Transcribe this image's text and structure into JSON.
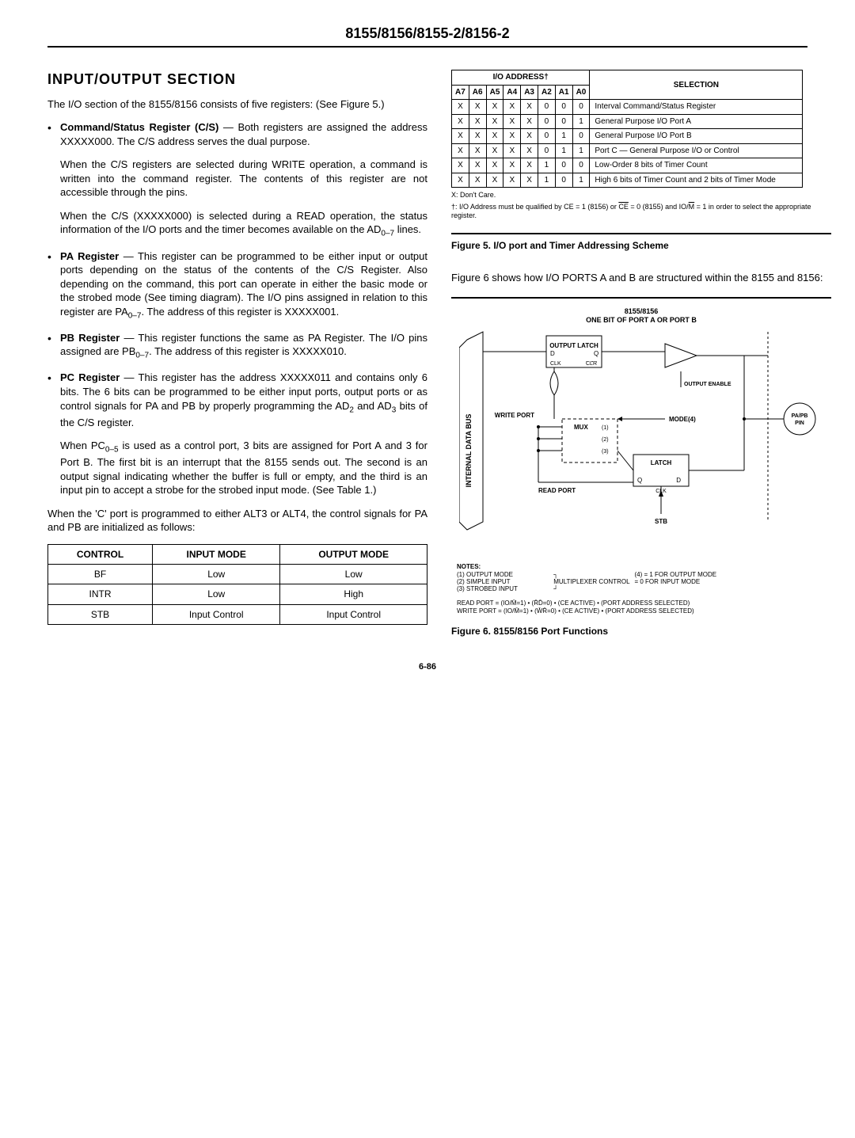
{
  "header": {
    "title": "8155/8156/8155-2/8156-2"
  },
  "left": {
    "section_title": "INPUT/OUTPUT SECTION",
    "intro": "The I/O section of the 8155/8156 consists of five registers: (See Figure 5.)",
    "cs_title": "Command/Status Register (C/S)",
    "cs_p1": " — Both registers are assigned the address XXXXX000. The C/S address serves the dual purpose.",
    "cs_p2": "When the C/S registers are selected during WRITE operation, a command is written into the command register. The contents of this register are not accessible through the pins.",
    "cs_p3_a": "When the C/S (XXXXX000) is selected during a READ operation, the status information of the I/O ports and the timer becomes available on the AD",
    "cs_p3_b": " lines.",
    "pa_title": "PA Register",
    "pa_p1_a": " — This register can be programmed to be either input or output ports depending on the status of the contents of the C/S Register. Also depending on the command, this port can operate in either the basic mode or the strobed mode (See timing diagram). The I/O pins assigned in relation to this register are PA",
    "pa_p1_b": ". The address of this register is XXXXX001.",
    "pb_title": "PB Register",
    "pb_p1_a": " — This register functions the same as PA Register. The I/O pins assigned are PB",
    "pb_p1_b": ". The address of this register is XXXXX010.",
    "pc_title": "PC Register",
    "pc_p1_a": " — This register has the address XXXXX011 and contains only 6 bits. The 6 bits can be programmed to be either input ports, output ports or as control signals for PA and PB by properly programming the AD",
    "pc_p1_b": " and AD",
    "pc_p1_c": " bits of the C/S register.",
    "pc_p2_a": "When PC",
    "pc_p2_b": " is used as a control port, 3 bits are assigned for Port A and 3 for Port B. The first bit is an interrupt that the 8155 sends out. The second is an output signal indicating whether the buffer is full or empty, and the third is an input pin to accept a strobe for the strobed input mode. (See Table 1.)",
    "alt_para": "When the 'C' port is programmed to either ALT3 or ALT4, the control signals for PA and PB are initialized as follows:",
    "ctrl_table": {
      "headers": [
        "CONTROL",
        "INPUT MODE",
        "OUTPUT MODE"
      ],
      "rows": [
        [
          "BF",
          "Low",
          "Low"
        ],
        [
          "INTR",
          "Low",
          "High"
        ],
        [
          "STB",
          "Input Control",
          "Input Control"
        ]
      ]
    }
  },
  "right": {
    "addr_header_group": "I/O ADDRESS†",
    "addr_header_sel": "SELECTION",
    "addr_cols": [
      "A7",
      "A6",
      "A5",
      "A4",
      "A3",
      "A2",
      "A1",
      "A0"
    ],
    "addr_rows": [
      {
        "bits": [
          "X",
          "X",
          "X",
          "X",
          "X",
          "0",
          "0",
          "0"
        ],
        "sel": "Interval Command/Status Register"
      },
      {
        "bits": [
          "X",
          "X",
          "X",
          "X",
          "X",
          "0",
          "0",
          "1"
        ],
        "sel": "General Purpose I/O Port A"
      },
      {
        "bits": [
          "X",
          "X",
          "X",
          "X",
          "X",
          "0",
          "1",
          "0"
        ],
        "sel": "General Purpose I/O Port B"
      },
      {
        "bits": [
          "X",
          "X",
          "X",
          "X",
          "X",
          "0",
          "1",
          "1"
        ],
        "sel": "Port C — General Purpose I/O or Control"
      },
      {
        "bits": [
          "X",
          "X",
          "X",
          "X",
          "X",
          "1",
          "0",
          "0"
        ],
        "sel": "Low-Order 8 bits of Timer Count"
      },
      {
        "bits": [
          "X",
          "X",
          "X",
          "X",
          "X",
          "1",
          "0",
          "1"
        ],
        "sel": "High 6 bits of Timer Count and 2 bits of Timer Mode"
      }
    ],
    "foot_x": "X: Don't Care.",
    "foot_t_a": "†: I/O Address must be qualified by CE = 1 (8156) or ",
    "foot_t_b": " = 0 (8155) and IO/",
    "foot_t_c": " = 1 in order to select the appropriate register.",
    "fig5": "Figure 5.  I/O port and Timer Addressing Scheme",
    "fig6_intro": "Figure 6 shows how I/O PORTS A and B are structured within the 8155 and 8156:",
    "diagram": {
      "chip": "8155/8156",
      "subtitle": "ONE BIT OF PORT A OR PORT B",
      "output_latch": "OUTPUT LATCH",
      "d": "D",
      "q": "Q",
      "clk": "CLK",
      "clr": "CLR",
      "output_enable": "OUTPUT ENABLE",
      "write_port": "WRITE PORT",
      "mux": "MUX",
      "mode": "MODE(4)",
      "latch": "LATCH",
      "read_port": "READ PORT",
      "stb": "STB",
      "int_bus": "INTERNAL DATA BUS",
      "pin": "PA/PB PIN",
      "notes_h": "NOTES:",
      "note1": "(1)  OUTPUT MODE",
      "note2": "(2)  SIMPLE INPUT",
      "note3": "(3)  STROBED INPUT",
      "mux_ctrl": "MULTIPLEXER CONTROL",
      "note4a": "(4)  = 1 FOR OUTPUT MODE",
      "note4b": "       = 0 FOR INPUT MODE",
      "read_eq": "READ PORT = (IO/M̄=1) • (R̄D̄=0) • (CE ACTIVE) • (PORT ADDRESS SELECTED)",
      "write_eq": "WRITE PORT = (IO/M̄=1) • (W̄R̄=0) • (CE ACTIVE) • (PORT ADDRESS SELECTED)"
    },
    "fig6": "Figure 6.  8155/8156 Port Functions"
  },
  "footer": {
    "pg": "6-86"
  }
}
